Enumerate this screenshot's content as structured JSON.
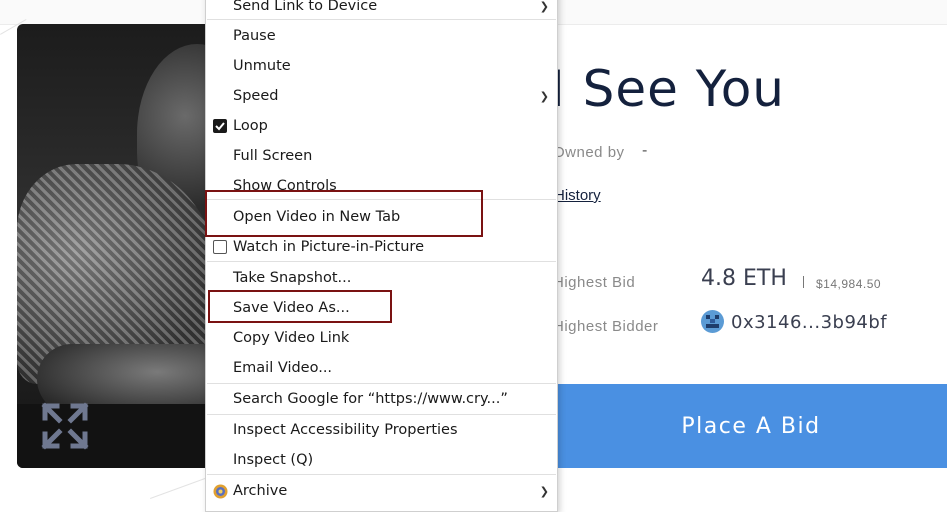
{
  "nft": {
    "title": "I See You",
    "owned_by_label": "Owned by",
    "owned_by_value": "-",
    "history_link": "History",
    "highest_bid_label": "Highest Bid",
    "highest_bid_value": "4.8 ETH",
    "highest_bid_usd": "$14,984.50",
    "highest_bidder_label": "Highest Bidder",
    "highest_bidder_address": "0x3146...3b94bf",
    "place_bid_label": "Place A Bid"
  },
  "video": {
    "fullscreen_icon": "expand-arrows-icon"
  },
  "context_menu": {
    "items": [
      {
        "label": "Send Link to Device",
        "submenu": true
      },
      {
        "label": "Pause"
      },
      {
        "label": "Unmute"
      },
      {
        "label": "Speed",
        "submenu": true
      },
      {
        "label": "Loop",
        "checked": true
      },
      {
        "label": "Full Screen"
      },
      {
        "label": "Show Controls"
      },
      {
        "label": "Open Video in New Tab"
      },
      {
        "label": "Watch in Picture-in-Picture",
        "checked": false
      },
      {
        "label": "Take Snapshot..."
      },
      {
        "label": "Save Video As..."
      },
      {
        "label": "Copy Video Link"
      },
      {
        "label": "Email Video..."
      },
      {
        "label": "Search Google for “https://www.cry...”"
      },
      {
        "label": "Inspect Accessibility Properties"
      },
      {
        "label": "Inspect (Q)"
      },
      {
        "label": "Archive",
        "submenu": true
      }
    ]
  },
  "colors": {
    "accent_button": "#4a90e2",
    "title_text": "#14213d",
    "highlight_box": "#7a1212"
  }
}
